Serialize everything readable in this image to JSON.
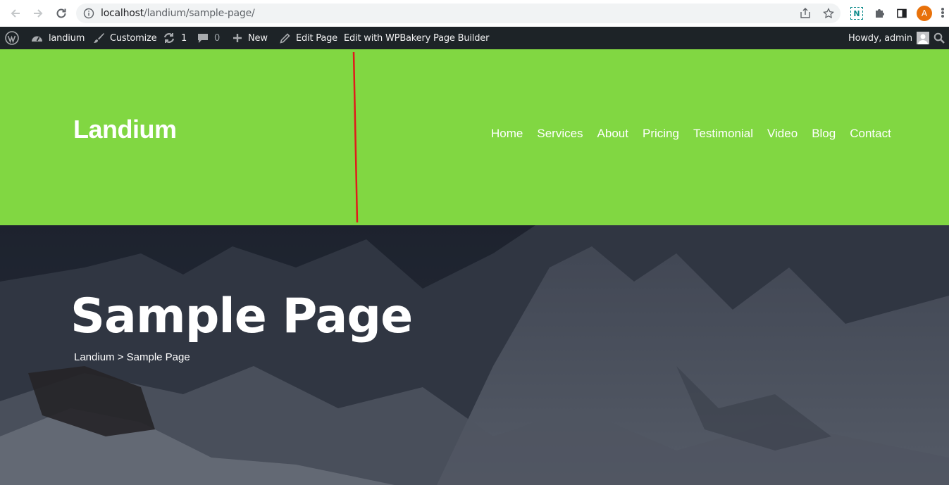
{
  "browser": {
    "url_host": "localhost",
    "url_path": "/landium/sample-page/",
    "profile_initial": "A",
    "extension_label": "N"
  },
  "adminbar": {
    "site_name": "landium",
    "customize": "Customize",
    "updates_count": "1",
    "comments_count": "0",
    "new_label": "New",
    "edit_page": "Edit Page",
    "wpbakery": "Edit with WPBakery Page Builder",
    "howdy": "Howdy, admin"
  },
  "header": {
    "site_title": "Landium",
    "nav": [
      "Home",
      "Services",
      "About",
      "Pricing",
      "Testimonial",
      "Video",
      "Blog",
      "Contact"
    ],
    "bg_color": "#81d742"
  },
  "hero": {
    "title": "Sample Page",
    "breadcrumb": "Landium > Sample Page"
  },
  "colors": {
    "accent": "#81d742",
    "adminbar": "#1d2327",
    "annotation": "#e01b1b"
  }
}
